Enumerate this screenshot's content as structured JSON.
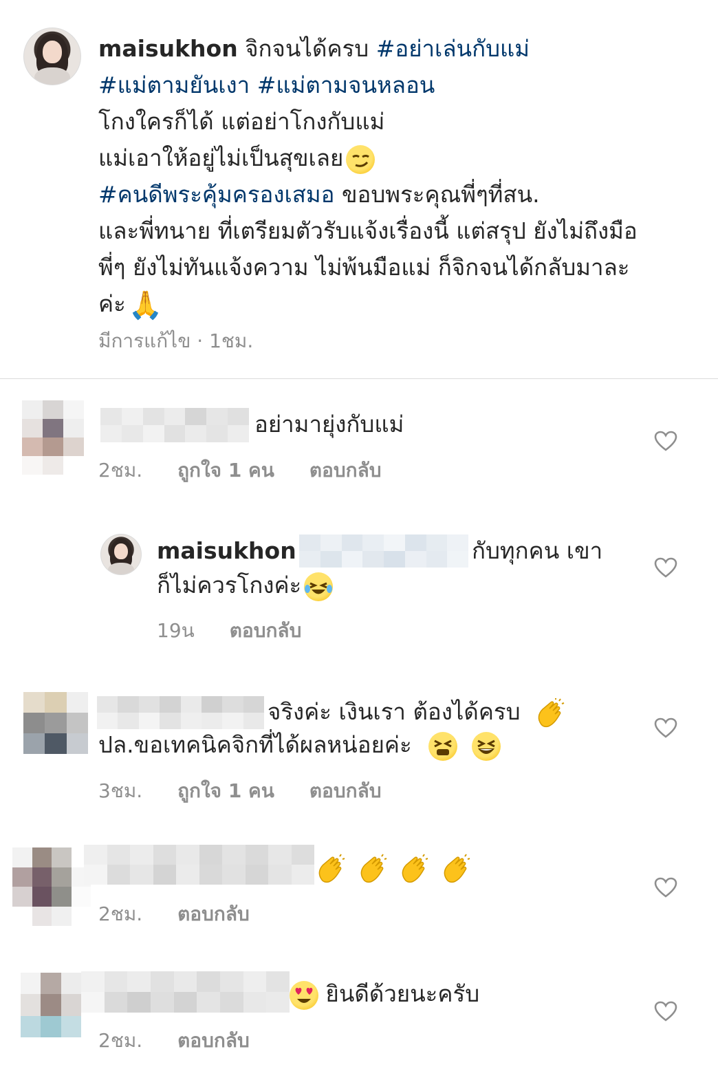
{
  "post": {
    "username": "maisukhon",
    "caption_line1_text": "จิกจนได้ครบ",
    "hashtag1": "#อย่าเล่นกับแม่",
    "hashtag2": "#แม่ตามยันเงา",
    "hashtag3": "#แม่ตามจนหลอน",
    "line3": "โกงใครก็ได้ แต่อย่าโกงกับแม่",
    "line4": "แม่เอาให้อยู่ไม่เป็นสุขเลย",
    "line4_emoji": "smirk-emoji",
    "hashtag4": "#คนดีพระคุ้มครองเสมอ",
    "line5_text": "ขอบพระคุณพี่ๆที่สน.",
    "line6": "และพี่ทนาย ที่เตรียมตัวรับแจ้งเรื่องนี้ แต่สรุป ยังไม่ถึงมือ",
    "line7": "พี่ๆ ยังไม่ทันแจ้งความ ไม่พ้นมือแม่ ก็จิกจนได้กลับมาละ",
    "line8": "ค่ะ",
    "line8_emoji": "🙏",
    "meta": "มีการแก้ไข · 1ชม."
  },
  "comments": [
    {
      "text": "อย่ามายุ่งกับแม่",
      "time": "2ชม.",
      "likes": "ถูกใจ 1 คน",
      "reply": "ตอบกลับ"
    },
    {
      "username": "maisukhon",
      "text_line1": "กับทุกคน เขา",
      "text_line2": "ก็ไม่ควรโกงค่ะ",
      "emoji": "laughing-tears-emoji",
      "time": "19น",
      "reply": "ตอบกลับ"
    },
    {
      "text_line1": "จริงค่ะ เงินเรา ต้องได้ครบ",
      "text_line2": "ปล.ขอเทคนิคจิกที่ได้ผลหน่อยค่ะ",
      "emojis": [
        "clap-emoji",
        "tired-face-emoji",
        "grinning-squint-emoji"
      ],
      "time": "3ชม.",
      "likes": "ถูกใจ 1 คน",
      "reply": "ตอบกลับ"
    },
    {
      "emojis": [
        "clap-emoji",
        "clap-emoji",
        "clap-emoji",
        "clap-emoji"
      ],
      "time": "2ชม.",
      "reply": "ตอบกลับ"
    },
    {
      "text": "ยินดีด้วยนะครับ",
      "emoji": "heart-eyes-emoji",
      "time": "2ชม.",
      "reply": "ตอบกลับ"
    }
  ],
  "colors": {
    "text": "#262626",
    "hashtag": "#00376b",
    "meta": "#8e8e8e",
    "divider": "#dbdbdb"
  }
}
